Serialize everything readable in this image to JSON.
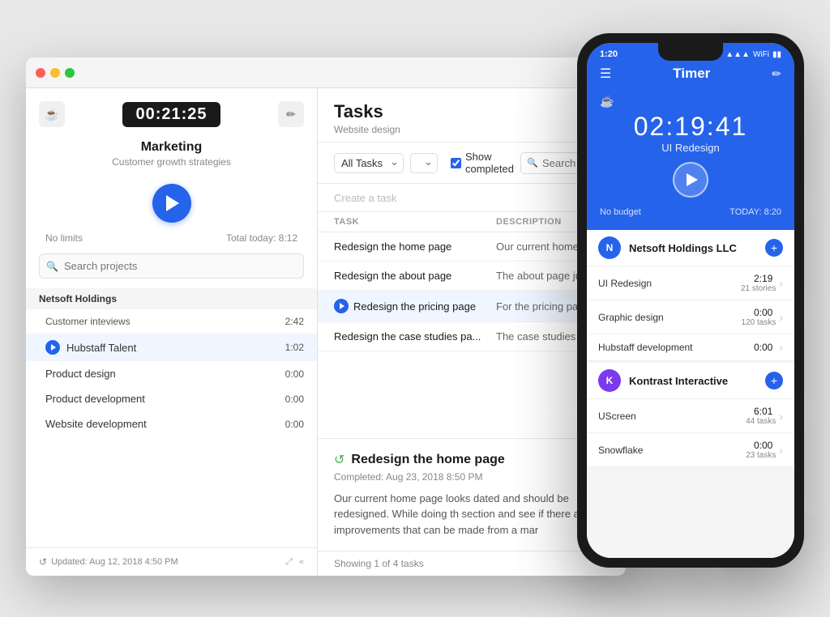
{
  "window": {
    "timer": "00:21:25",
    "project_name": "Marketing",
    "project_subtitle": "Customer growth strategies",
    "no_limits": "No limits",
    "total_today": "Total today: 8:12",
    "search_placeholder": "Search projects",
    "footer_updated": "Updated: Aug 12, 2018 4:50 PM",
    "footer_showing": "Showing 1 of 4 tasks"
  },
  "sidebar": {
    "group": "Netsoft Holdings",
    "projects": [
      {
        "name": "Customer inteviews",
        "time": "2:42",
        "active": false
      },
      {
        "name": "Hubstaff Talent",
        "time": "1:02",
        "active": true
      },
      {
        "name": "Product design",
        "time": "0:00",
        "active": false
      },
      {
        "name": "Product development",
        "time": "0:00",
        "active": false
      },
      {
        "name": "Website development",
        "time": "0:00",
        "active": false
      }
    ]
  },
  "tasks": {
    "title": "Tasks",
    "subtitle": "Website design",
    "filter_label": "All Tasks",
    "show_completed_label": "Show completed",
    "search_placeholder": "Search tasks",
    "create_placeholder": "Create a task",
    "columns": [
      "TASK",
      "DESCRIPTION"
    ],
    "rows": [
      {
        "name": "Redesign the home page",
        "desc": "Our current home page looks dated an",
        "active": false
      },
      {
        "name": "Redesign the about page",
        "desc": "The about page just needs a bit of ma",
        "active": false
      },
      {
        "name": "Redesign the pricing page",
        "desc": "For the pricing page, we need to try ou",
        "active": true
      },
      {
        "name": "Redesign the case studies pa...",
        "desc": "The case studies page is probably the",
        "active": false
      }
    ],
    "detail": {
      "title": "Redesign the home page",
      "completed": "Completed: Aug 23, 2018 8:50 PM",
      "description": "Our current home page looks dated and should be redesigned. While doing th section and see if there are any improvements that can be made from a mar"
    }
  },
  "phone": {
    "status_time": "1:20",
    "nav_title": "Timer",
    "timer_time": "02:19:41",
    "timer_project": "UI Redesign",
    "no_budget": "No budget",
    "today": "TODAY: 8:20",
    "groups": [
      {
        "name": "Netsoft Holdings LLC",
        "avatar_letter": "N",
        "avatar_color": "blue",
        "projects": [
          {
            "name": "UI Redesign",
            "time": "2:19",
            "sub": "21 stories"
          },
          {
            "name": "Graphic design",
            "time": "0:00",
            "sub": "120 tasks"
          },
          {
            "name": "Hubstaff development",
            "time": "0:00",
            "sub": ""
          }
        ]
      },
      {
        "name": "Kontrast Interactive",
        "avatar_letter": "K",
        "avatar_color": "purple",
        "projects": [
          {
            "name": "UScreen",
            "time": "6:01",
            "sub": "44 tasks"
          },
          {
            "name": "Snowflake",
            "time": "0:00",
            "sub": "23 tasks"
          }
        ]
      }
    ]
  }
}
